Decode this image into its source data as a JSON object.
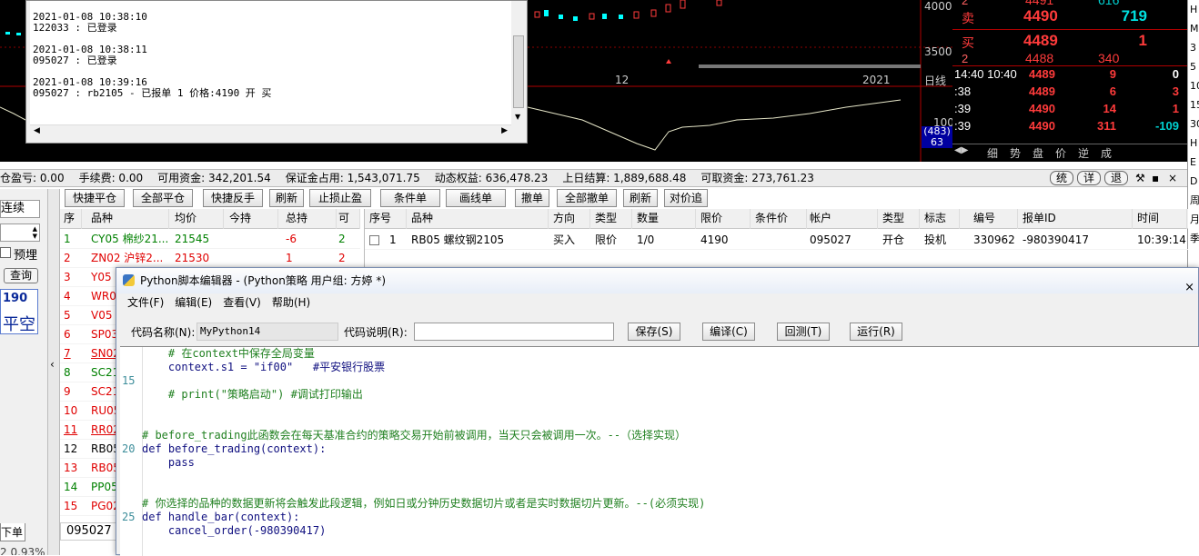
{
  "log": {
    "lines": [
      "2021-01-08 10:38:10",
      "122033 : 已登录",
      "",
      "2021-01-08 10:38:11",
      "095027 : 已登录",
      "",
      "2021-01-08 10:39:16",
      "095027 : rb2105 - 已报单 1 价格:4190 开 买"
    ]
  },
  "chart": {
    "price_labels": [
      "4000",
      "3500",
      "100"
    ],
    "x_labels": [
      "12",
      "2021"
    ],
    "period_label": "日线",
    "indicator_values": [
      "(483)",
      "63"
    ]
  },
  "quote": {
    "sell": {
      "label": "卖",
      "price": "4490",
      "vol": "719"
    },
    "buy": {
      "label": "买",
      "price": "4489",
      "vol": "1"
    },
    "buy2": {
      "label": "2",
      "price": "4488",
      "vol": "340"
    },
    "top_partial": {
      "price": "4491",
      "vol": "616"
    },
    "ticks": [
      {
        "time": "14:40 10:40",
        "price": "4489",
        "vol": "9",
        "chg": "0",
        "chgcolor": "#ffffff",
        "pcolor": "#ff3b3b",
        "vcolor": "#ff3b3b"
      },
      {
        "time": ":38",
        "price": "4489",
        "vol": "6",
        "chg": "3",
        "chgcolor": "#ff3b3b",
        "pcolor": "#ff3b3b",
        "vcolor": "#ff3b3b"
      },
      {
        "time": ":39",
        "price": "4490",
        "vol": "14",
        "chg": "1",
        "chgcolor": "#ff3b3b",
        "pcolor": "#ff3b3b",
        "vcolor": "#ff3b3b"
      },
      {
        "time": ":39",
        "price": "4490",
        "vol": "311",
        "chg": "-109",
        "chgcolor": "#00d0d0",
        "pcolor": "#ff3b3b",
        "vcolor": "#ff3b3b"
      }
    ],
    "tabs": [
      "细",
      "势",
      "盘",
      "价",
      "逆",
      "成"
    ]
  },
  "edge_items": [
    "H",
    "M",
    "3",
    "5",
    "10",
    "15",
    "30",
    "H",
    "E",
    "D",
    "周",
    "月",
    "季"
  ],
  "account": {
    "items": [
      "仓盈亏: 0.00",
      "手续费: 0.00",
      "可用资金: 342,201.54",
      "保证金占用: 1,543,071.75",
      "动态权益: 636,478.23",
      "上日结算: 1,889,688.48",
      "可取资金: 273,761.23"
    ],
    "right_buttons": [
      "统",
      "详",
      "退"
    ]
  },
  "toolbar": {
    "left_buttons": [
      "快捷平仓",
      "全部平仓",
      "快捷反手",
      "刷新",
      "止损止盈"
    ],
    "right_buttons": [
      "条件单",
      "画线单",
      "撤单",
      "全部撤单",
      "刷新",
      "对价追"
    ]
  },
  "left_panel": {
    "label_lianxu": "连续",
    "checkbox_label": "预埋",
    "query_button": "查询",
    "price_partial": "190",
    "pingkong": "平空",
    "bottom_tab": "下单",
    "bottom_status": "2 0.93%"
  },
  "positions": {
    "headers": [
      "序",
      "品种",
      "均价",
      "今持",
      "总持",
      "可"
    ],
    "rows": [
      {
        "no": "1",
        "name": "CY05 棉纱21...",
        "avg": "21545",
        "today": "",
        "total": "-6",
        "avail": "2",
        "color": "#008000"
      },
      {
        "no": "2",
        "name": "ZN02 沪锌2...",
        "avg": "21530",
        "today": "",
        "total": "1",
        "avail": "2",
        "color": "#e00000"
      },
      {
        "no": "3",
        "name": "Y05",
        "avg": "",
        "today": "",
        "total": "",
        "avail": "",
        "color": "#e00000"
      },
      {
        "no": "4",
        "name": "WR0",
        "avg": "",
        "today": "",
        "total": "",
        "avail": "",
        "color": "#e00000"
      },
      {
        "no": "5",
        "name": "V05",
        "avg": "",
        "today": "",
        "total": "",
        "avail": "",
        "color": "#e00000"
      },
      {
        "no": "6",
        "name": "SP03",
        "avg": "",
        "today": "",
        "total": "",
        "avail": "",
        "color": "#e00000"
      },
      {
        "no": "7",
        "name": "SN02",
        "avg": "",
        "today": "",
        "total": "",
        "avail": "",
        "color": "#e00000"
      },
      {
        "no": "8",
        "name": "SC21",
        "avg": "",
        "today": "",
        "total": "",
        "avail": "",
        "color": "#008000"
      },
      {
        "no": "9",
        "name": "SC21",
        "avg": "",
        "today": "",
        "total": "",
        "avail": "",
        "color": "#e00000"
      },
      {
        "no": "10",
        "name": "RU05",
        "avg": "",
        "today": "",
        "total": "",
        "avail": "",
        "color": "#e00000"
      },
      {
        "no": "11",
        "name": "RR02",
        "avg": "",
        "today": "",
        "total": "",
        "avail": "",
        "color": "#e00000"
      },
      {
        "no": "12",
        "name": "RB05",
        "avg": "",
        "today": "",
        "total": "",
        "avail": "",
        "color": "#000000"
      },
      {
        "no": "13",
        "name": "RB05",
        "avg": "",
        "today": "",
        "total": "",
        "avail": "",
        "color": "#e00000"
      },
      {
        "no": "14",
        "name": "PP05",
        "avg": "",
        "today": "",
        "total": "",
        "avail": "",
        "color": "#008000"
      },
      {
        "no": "15",
        "name": "PG02",
        "avg": "",
        "today": "",
        "total": "",
        "avail": "",
        "color": "#e00000"
      }
    ],
    "footer_account": "095027"
  },
  "orders": {
    "headers": [
      "序号",
      "品种",
      "方向",
      "类型",
      "数量",
      "限价",
      "条件价",
      "帐户",
      "类型",
      "标志",
      "编号",
      "报单ID",
      "时间"
    ],
    "rows": [
      {
        "no": "1",
        "name": "RB05 螺纹钢2105",
        "dir": "买入",
        "type": "限价",
        "qty": "1/0",
        "price": "4190",
        "cond": "",
        "acct": "095027",
        "otype": "开仓",
        "flag": "投机",
        "id": "330962",
        "orderid": "-980390417",
        "time": "10:39:14"
      }
    ]
  },
  "py": {
    "title": "Python脚本编辑器 - (Python策略 用户组: 方婷 *)",
    "menu": [
      "文件(F)",
      "编辑(E)",
      "查看(V)",
      "帮助(H)"
    ],
    "code_name_label": "代码名称(N):",
    "code_name_value": "MyPython14",
    "code_desc_label": "代码说明(R):",
    "code_desc_value": "",
    "buttons": [
      "保存(S)",
      "编译(C)",
      "回测(T)",
      "运行(R)"
    ],
    "lines": [
      {
        "n": "",
        "t": "    # 在context中保存全局变量",
        "k": "cm"
      },
      {
        "n": "",
        "t": "    context.s1 = \"if00\"   #平安银行股票",
        "k": "mix"
      },
      {
        "n": "15",
        "t": "",
        "k": ""
      },
      {
        "n": "",
        "t": "    # print(\"策略启动\") #调试打印输出",
        "k": "cm"
      },
      {
        "n": "",
        "t": "",
        "k": ""
      },
      {
        "n": "",
        "t": "",
        "k": ""
      },
      {
        "n": "",
        "t": "# before_trading此函数会在每天基准合约的策略交易开始前被调用，当天只会被调用一次。--（选择实现）",
        "k": "cm"
      },
      {
        "n": "20",
        "t": "def before_trading(context):",
        "k": "kw"
      },
      {
        "n": "",
        "t": "    pass",
        "k": "kw"
      },
      {
        "n": "",
        "t": "",
        "k": ""
      },
      {
        "n": "",
        "t": "",
        "k": ""
      },
      {
        "n": "",
        "t": "# 你选择的品种的数据更新将会触发此段逻辑，例如日或分钟历史数据切片或者是实时数据切片更新。--(必须实现)",
        "k": "cm"
      },
      {
        "n": "25",
        "t": "def handle_bar(context):",
        "k": "kw"
      },
      {
        "n": "",
        "t": "    cancel_order(-980390417)",
        "k": "kw"
      }
    ]
  }
}
